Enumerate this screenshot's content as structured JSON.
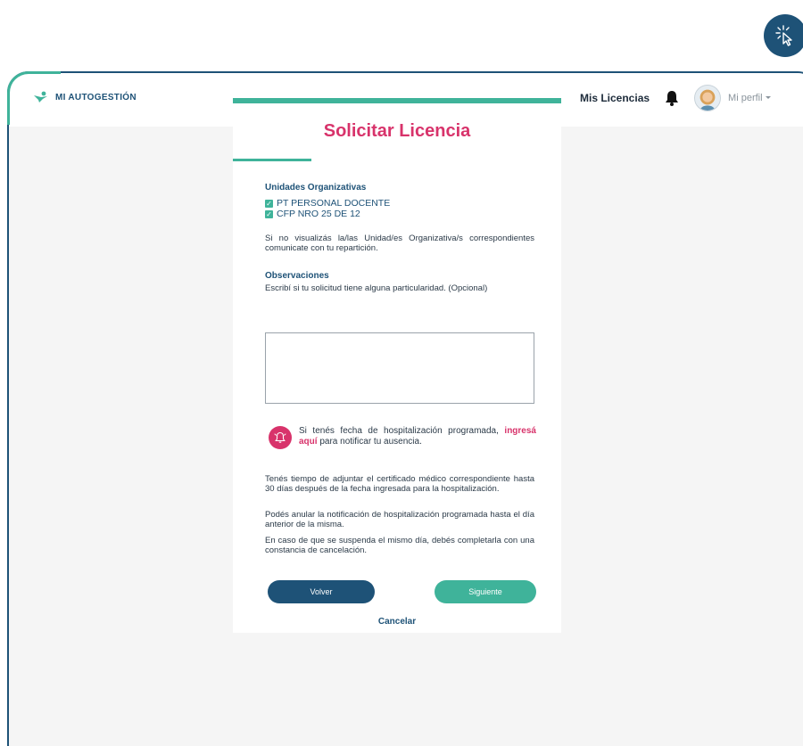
{
  "brand": {
    "name": "MI AUTOGESTIÓN",
    "icon": "person-logo-icon"
  },
  "nav": {
    "my_licenses": "Mis Licencias",
    "bell_icon": "bell-icon",
    "profile": "Mi perfil"
  },
  "form": {
    "title": "Solicitar Licencia",
    "units_label": "Unidades Organizativas",
    "units": [
      "PT PERSONAL DOCENTE",
      "CFP NRO 25 DE 12"
    ],
    "units_note": "Si no visualizás la/las Unidad/es Organizativa/s correspondientes comunicate con tu repartición.",
    "observations_label": "Observaciones",
    "observations_hint": "Escribí si tu solicitud tiene alguna particularidad. (Opcional)",
    "observations_value": "",
    "hospitalization": {
      "text_before": "Si tenés fecha de hospitalización programada,",
      "link": "ingresá aquí",
      "text_after": "para notificar tu ausencia."
    },
    "info_1": "Tenés tiempo de adjuntar el certificado médico correspondiente hasta 30 días después de la fecha ingresada para la hospitalización.",
    "info_2": "Podés anular la notificación de hospitalización programada hasta el día anterior de la misma.",
    "info_3": "En caso de que se suspenda el mismo día, debés completarla con una constancia de cancelación.",
    "back_button": "Volver",
    "next_button": "Siguiente",
    "cancel": "Cancelar"
  },
  "colors": {
    "primary": "#1e5277",
    "accent": "#3fb39a",
    "highlight": "#d8336b"
  }
}
